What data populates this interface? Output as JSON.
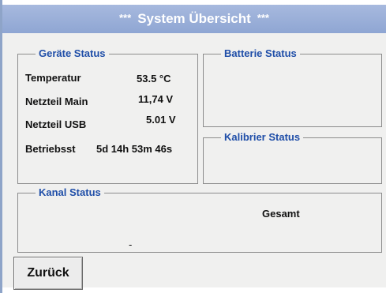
{
  "title": {
    "stars_left": "***",
    "text": "System Übersicht",
    "stars_right": "***"
  },
  "geraete_status": {
    "legend": "Geräte Status",
    "rows": [
      {
        "label": "Temperatur",
        "value": "53.5 °C"
      },
      {
        "label": "Netzteil Main",
        "value": "11,74 V"
      },
      {
        "label": "Netzteil USB",
        "value": "5.01 V"
      },
      {
        "label": "Betriebsst",
        "value": "5d 14h 53m 46s"
      }
    ]
  },
  "batterie_status": {
    "legend": "Batterie Status"
  },
  "kalibrier_status": {
    "legend": "Kalibrier Status"
  },
  "kanal_status": {
    "legend": "Kanal Status",
    "gesamt_label": "Gesamt",
    "value": "-"
  },
  "buttons": {
    "back_label": "Zurück"
  },
  "colors": {
    "title_bar": "#9cb0d9",
    "legend_text": "#1f4ea8",
    "panel_bg": "#f0f0ef"
  }
}
